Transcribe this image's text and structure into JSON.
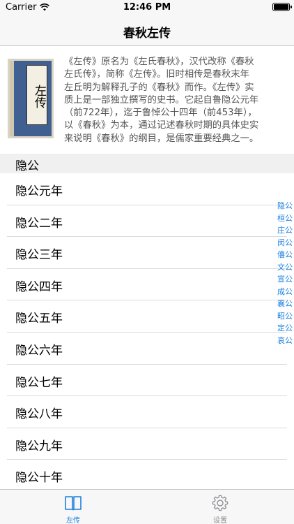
{
  "status_bar": {
    "carrier": "Carrier",
    "time": "12:46 PM",
    "battery_level": 1.0
  },
  "nav": {
    "title": "春秋左传"
  },
  "intro": {
    "cover_label": "左传",
    "lines": [
      "《左传》原名为《左氏春秋》，汉代改称《春秋",
      "左氏传》，简称《左传》。旧时相传是春秋末年",
      "左丘明为解释孔子的《春秋》而作。《左传》实",
      "质上是一部独立撰写的史书。它起自鲁隐公元年",
      "（前722年），迄于鲁悼公十四年（前453年），",
      "以《春秋》为本，通过记述春秋时期的具体史实",
      "来说明《春秋》的纲目，是儒家重要经典之一。"
    ]
  },
  "section": {
    "title": "隐公"
  },
  "chapters": [
    "隐公元年",
    "隐公二年",
    "隐公三年",
    "隐公四年",
    "隐公五年",
    "隐公六年",
    "隐公七年",
    "隐公八年",
    "隐公九年",
    "隐公十年"
  ],
  "index": [
    "隐公",
    "桓公",
    "庄公",
    "闵公",
    "僖公",
    "文公",
    "宣公",
    "成公",
    "襄公",
    "昭公",
    "定公",
    "哀公"
  ],
  "tabs": [
    {
      "label": "左传",
      "icon": "book-icon",
      "active": true
    },
    {
      "label": "设置",
      "icon": "gear-icon",
      "active": false
    }
  ],
  "colors": {
    "accent": "#1a7fe0",
    "inactive": "#8e8e93"
  }
}
